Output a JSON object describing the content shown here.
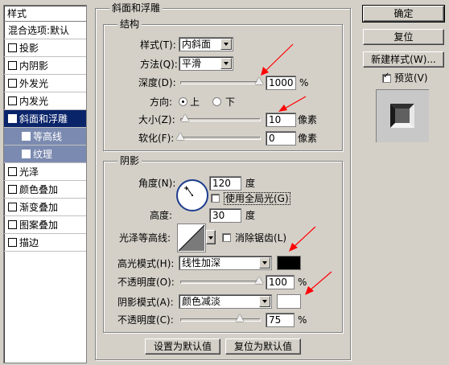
{
  "styles_panel": {
    "header": "样式",
    "items": [
      {
        "label": "混合选项:默认",
        "checkbox": false,
        "checked": false,
        "state": "normal"
      },
      {
        "label": "投影",
        "checkbox": true,
        "checked": false,
        "state": "normal"
      },
      {
        "label": "内阴影",
        "checkbox": true,
        "checked": false,
        "state": "normal"
      },
      {
        "label": "外发光",
        "checkbox": true,
        "checked": false,
        "state": "normal"
      },
      {
        "label": "内发光",
        "checkbox": true,
        "checked": false,
        "state": "normal"
      },
      {
        "label": "斜面和浮雕",
        "checkbox": true,
        "checked": true,
        "state": "selected"
      },
      {
        "label": "等高线",
        "checkbox": true,
        "checked": false,
        "state": "sub"
      },
      {
        "label": "纹理",
        "checkbox": true,
        "checked": false,
        "state": "sub"
      },
      {
        "label": "光泽",
        "checkbox": true,
        "checked": false,
        "state": "normal"
      },
      {
        "label": "颜色叠加",
        "checkbox": true,
        "checked": false,
        "state": "normal"
      },
      {
        "label": "渐变叠加",
        "checkbox": true,
        "checked": false,
        "state": "normal"
      },
      {
        "label": "图案叠加",
        "checkbox": true,
        "checked": false,
        "state": "normal"
      },
      {
        "label": "描边",
        "checkbox": true,
        "checked": false,
        "state": "normal"
      }
    ]
  },
  "bevel": {
    "title": "斜面和浮雕",
    "structure": {
      "title": "结构",
      "style_label": "样式(T):",
      "style_value": "内斜面",
      "technique_label": "方法(Q):",
      "technique_value": "平滑",
      "depth_label": "深度(D):",
      "depth_value": "1000",
      "depth_unit": "%",
      "depth_level": 1.0,
      "direction_label": "方向:",
      "direction_up": "上",
      "direction_down": "下",
      "size_label": "大小(Z):",
      "size_value": "10",
      "size_unit": "像素",
      "size_level": 0.06,
      "soften_label": "软化(F):",
      "soften_value": "0",
      "soften_unit": "像素",
      "soften_level": 0.0
    },
    "shading": {
      "title": "阴影",
      "angle_label": "角度(N):",
      "angle_value": "120",
      "angle_unit": "度",
      "global_light_label": "使用全局光(G)",
      "altitude_label": "高度:",
      "altitude_value": "30",
      "altitude_unit": "度",
      "gloss_contour_label": "光泽等高线:",
      "anti_alias_label": "消除锯齿(L)",
      "highlight_mode_label": "高光模式(H):",
      "highlight_mode_value": "线性加深",
      "highlight_color": "#000000",
      "highlight_opacity_label": "不透明度(O):",
      "highlight_opacity_value": "100",
      "highlight_opacity_unit": "%",
      "highlight_opacity_level": 1.0,
      "shadow_mode_label": "阴影模式(A):",
      "shadow_mode_value": "颜色减淡",
      "shadow_color": "#ffffff",
      "shadow_opacity_label": "不透明度(C):",
      "shadow_opacity_value": "75",
      "shadow_opacity_unit": "%",
      "shadow_opacity_level": 0.75
    },
    "make_default": "设置为默认值",
    "reset_default": "复位为默认值"
  },
  "right": {
    "ok": "确定",
    "reset": "复位",
    "new_style": "新建样式(W)...",
    "preview_label": "预览(V)",
    "preview_checked": true
  },
  "colors": {
    "selection": "#0a246a",
    "sub_item": "#7b8ab0",
    "annotation_arrow": "#ff0000"
  }
}
